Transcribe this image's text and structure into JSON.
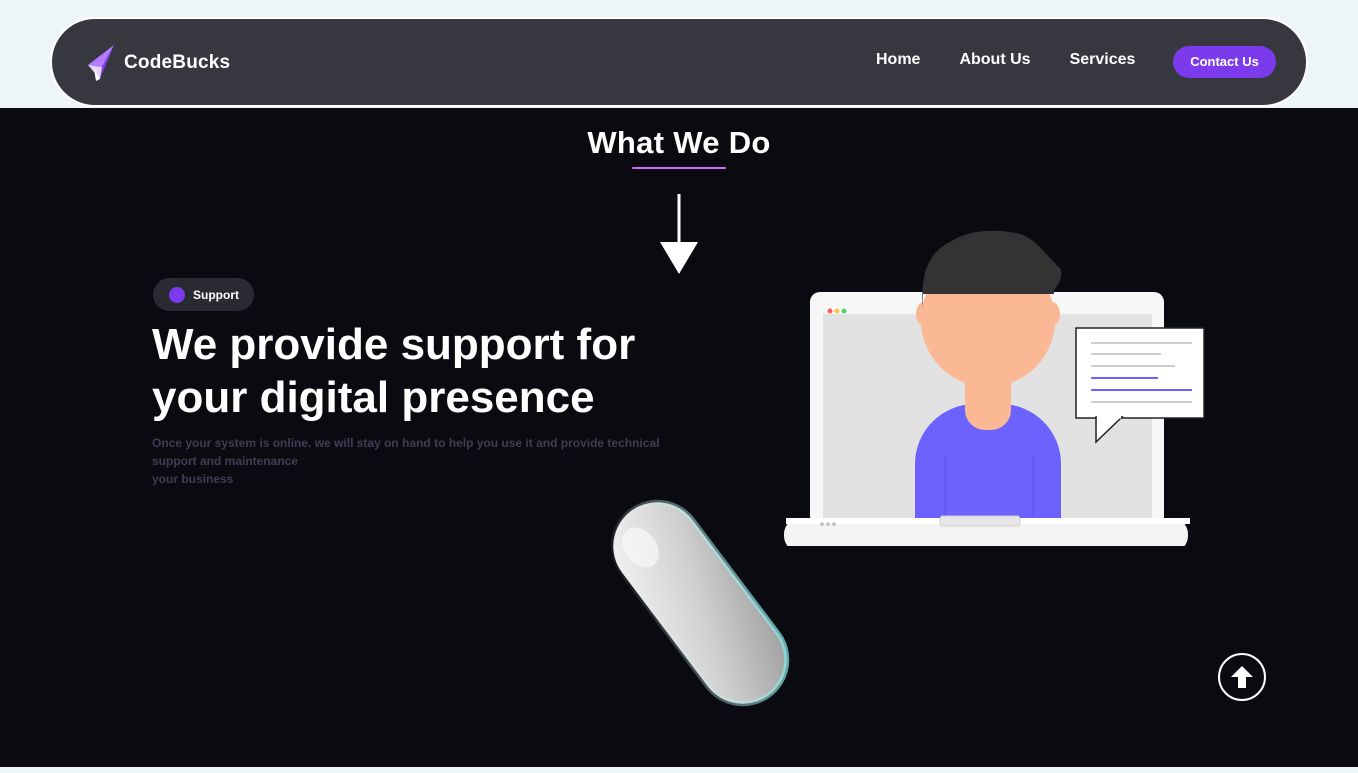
{
  "header": {
    "brand": "CodeBucks",
    "nav": [
      "Home",
      "About Us",
      "Services"
    ],
    "contact_label": "Contact Us"
  },
  "section": {
    "title": "What We Do",
    "badge": "Support",
    "headline_line1": "We provide support for",
    "headline_line2": "your digital presence",
    "description_line1": "Once your system is online, we will stay on hand to help you use it and provide technical support and maintenance",
    "description_line2": "your business"
  },
  "colors": {
    "accent": "#7c3aed",
    "underline": "#d16bff",
    "navbar": "#373740",
    "background_dark": "#0a0b10"
  },
  "icons": [
    "logo-icon",
    "arrow-down-icon",
    "badge-dot-icon",
    "arrow-up-icon"
  ]
}
